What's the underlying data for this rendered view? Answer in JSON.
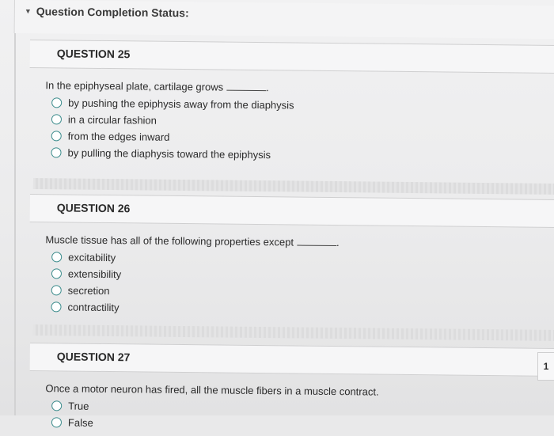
{
  "status": {
    "title": "Question Completion Status:"
  },
  "questions": [
    {
      "header": "QUESTION 25",
      "prompt": "In the epiphyseal plate, cartilage grows",
      "choices": [
        "by pushing the epiphysis away from the diaphysis",
        "in a circular fashion",
        "from the edges inward",
        "by pulling the diaphysis toward the epiphysis"
      ]
    },
    {
      "header": "QUESTION 26",
      "prompt": "Muscle tissue has all of the following properties except",
      "choices": [
        "excitability",
        "extensibility",
        "secretion",
        "contractility"
      ]
    },
    {
      "header": "QUESTION 27",
      "prompt": "Once a motor neuron has fired, all the muscle fibers in a muscle contract.",
      "choices": [
        "True",
        "False"
      ]
    }
  ],
  "side_tab": {
    "label": "1"
  }
}
